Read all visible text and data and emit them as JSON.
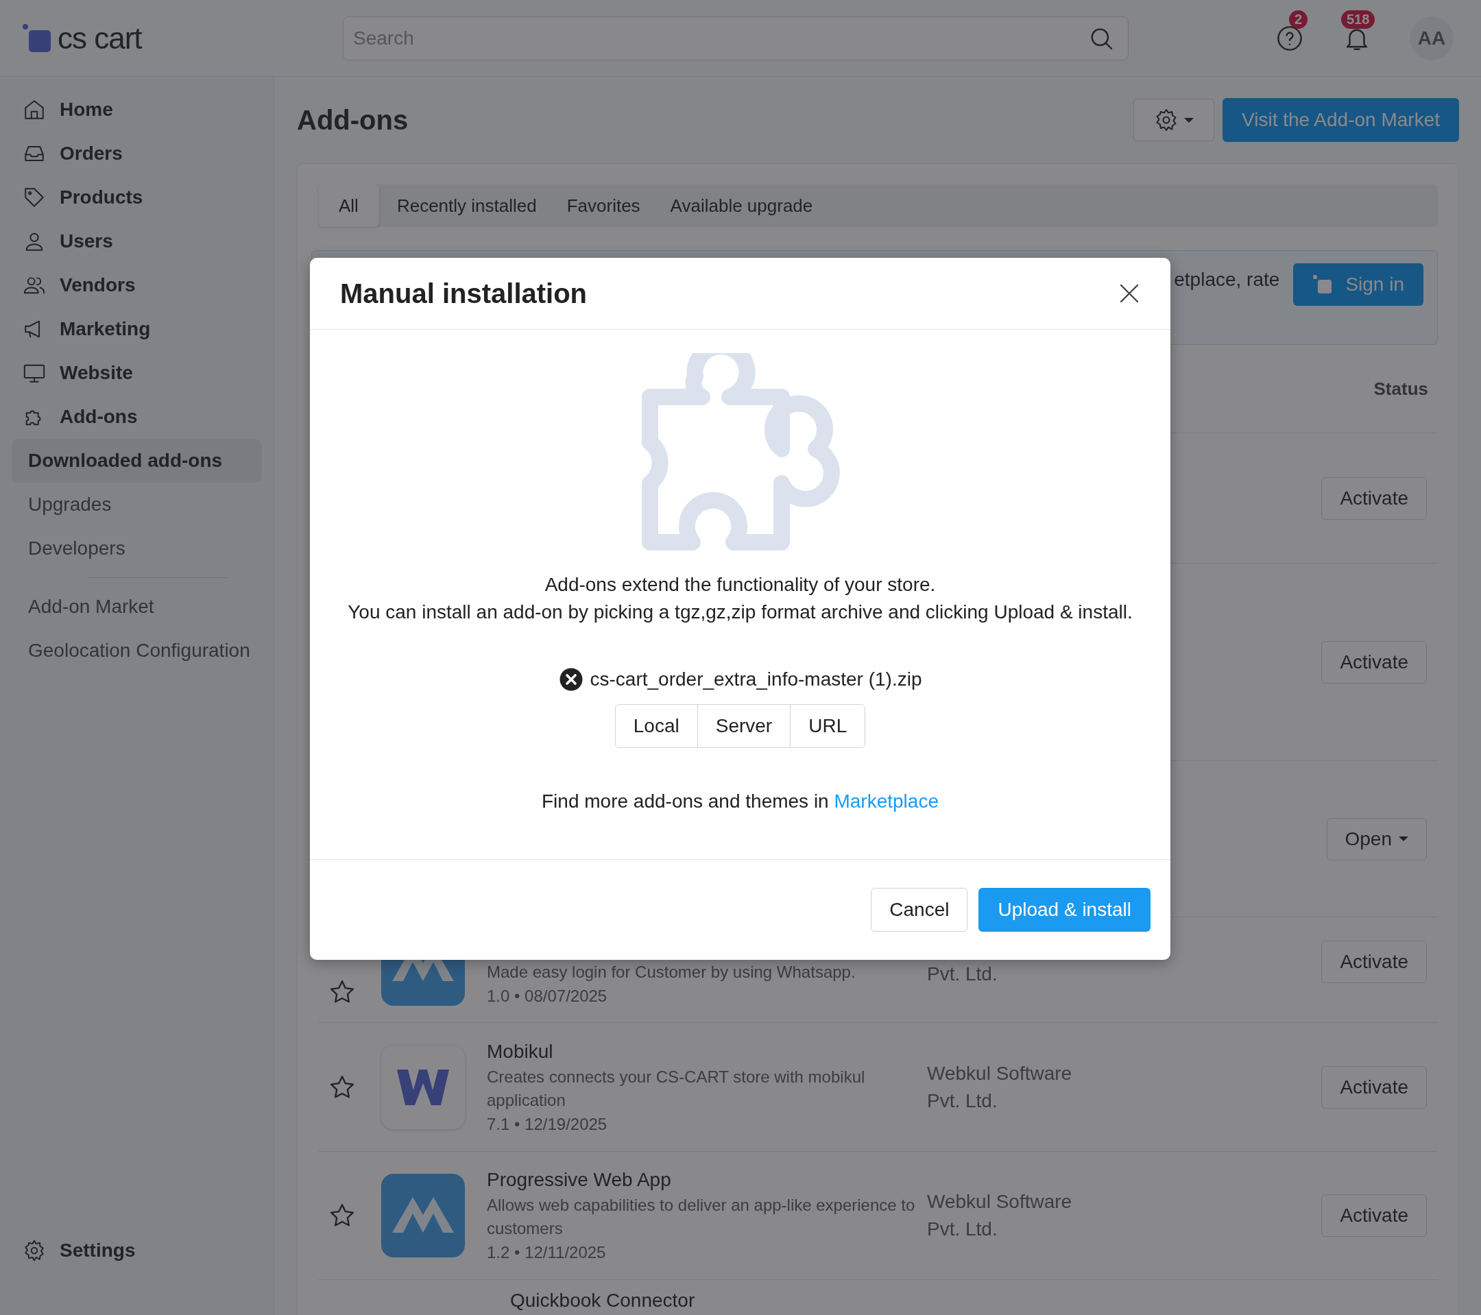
{
  "header": {
    "logo": "cs cart",
    "search": {
      "placeholder": "Search"
    },
    "help_badge": "2",
    "notifications_badge": "518",
    "avatar": "AA"
  },
  "sidebar": {
    "items": [
      {
        "label": "Home",
        "kind": "section"
      },
      {
        "label": "Orders",
        "kind": "section"
      },
      {
        "label": "Products",
        "kind": "section"
      },
      {
        "label": "Users",
        "kind": "section"
      },
      {
        "label": "Vendors",
        "kind": "section"
      },
      {
        "label": "Marketing",
        "kind": "section"
      },
      {
        "label": "Website",
        "kind": "section"
      },
      {
        "label": "Add-ons",
        "kind": "section"
      },
      {
        "label": "Downloaded add-ons",
        "kind": "sub",
        "selected": true
      },
      {
        "label": "Upgrades",
        "kind": "sub",
        "selected": false
      },
      {
        "label": "Developers",
        "kind": "sub",
        "selected": false
      },
      {
        "label": "Add-on Market",
        "kind": "sub",
        "selected": false,
        "divider_before": true
      },
      {
        "label": "Geolocation Configuration",
        "kind": "sub",
        "selected": false
      }
    ],
    "footer": "Settings"
  },
  "page": {
    "title": "Add-ons",
    "market_button": "Visit the Add-on Market"
  },
  "tabs": [
    {
      "label": "All",
      "selected": true
    },
    {
      "label": "Recently installed",
      "selected": false
    },
    {
      "label": "Favorites",
      "selected": false
    },
    {
      "label": "Available upgrade",
      "selected": false
    }
  ],
  "notice": {
    "text": "etplace, rate",
    "button": "Sign in"
  },
  "table": {
    "status_header": "Status",
    "rows": [
      {
        "kind": "hidden",
        "action": {
          "kind": "button",
          "label": "Activate"
        }
      },
      {
        "kind": "hidden",
        "action": {
          "kind": "button",
          "label": "Activate"
        }
      },
      {
        "kind": "hidden",
        "action": {
          "kind": "dropdown",
          "label": "Open"
        }
      },
      {
        "kind": "addon",
        "logo": {
          "kind": "tile"
        },
        "description": "Made easy login for Customer by using Whatsapp.",
        "meta": "1.0 • 08/07/2025",
        "vendor": [
          "Pvt. Ltd."
        ],
        "action": {
          "kind": "button",
          "label": "Activate"
        }
      },
      {
        "kind": "addon",
        "logo": {
          "kind": "letter"
        },
        "title": "Mobikul",
        "description": "Creates connects your CS-CART store with mobikul application",
        "meta": "7.1 • 12/19/2025",
        "vendor": [
          "Webkul Software",
          "Pvt. Ltd."
        ],
        "action": {
          "kind": "button",
          "label": "Activate"
        }
      },
      {
        "kind": "addon",
        "logo": {
          "kind": "tile"
        },
        "title": "Progressive Web App",
        "description": "Allows web capabilities to deliver an app-like experience to customers",
        "meta": "1.2 • 12/11/2025",
        "vendor": [
          "Webkul Software",
          "Pvt. Ltd."
        ],
        "action": {
          "kind": "button",
          "label": "Activate"
        }
      },
      {
        "kind": "cut",
        "title": "Quickbook Connector"
      }
    ]
  },
  "modal": {
    "title": "Manual installation",
    "lines": [
      "Add-ons extend the functionality of your store.",
      "You can install an add-on by picking a tgz,gz,zip format archive and clicking Upload & install."
    ],
    "file": "cs-cart_order_extra_info-master (1).zip",
    "sources": [
      "Local",
      "Server",
      "URL"
    ],
    "footer_text": "Find more add-ons and themes in ",
    "link": "Marketplace",
    "cancel": "Cancel",
    "submit": "Upload & install"
  }
}
